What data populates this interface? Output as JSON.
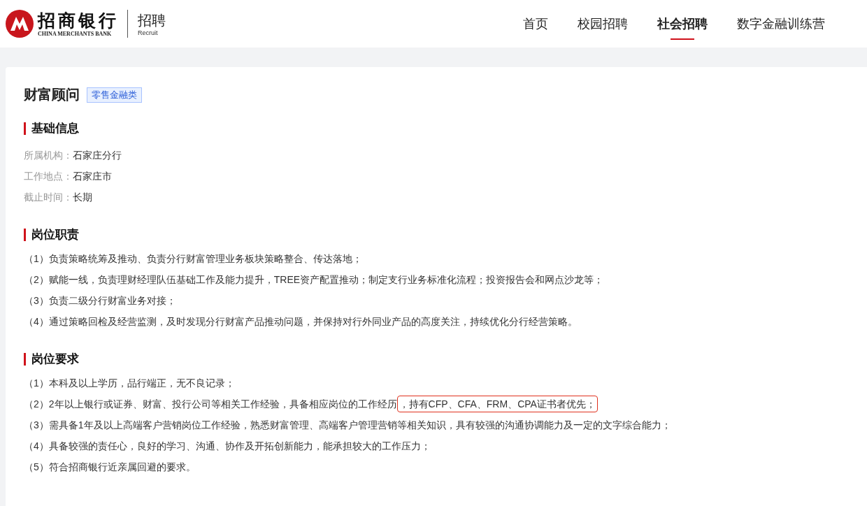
{
  "header": {
    "logo": {
      "name": "招商银行",
      "english": "CHINA MERCHANTS BANK",
      "section": "招聘",
      "section_english": "Recruit"
    },
    "nav": [
      {
        "label": "首页",
        "selected": false
      },
      {
        "label": "校园招聘",
        "selected": false
      },
      {
        "label": "社会招聘",
        "selected": true
      },
      {
        "label": "数字金融训练营",
        "selected": false
      }
    ]
  },
  "job": {
    "title": "财富顾问",
    "tag": "零售金融类",
    "sections": [
      {
        "heading": "基础信息",
        "kind": "fields",
        "fields": [
          {
            "label": "所属机构：",
            "value": "石家庄分行"
          },
          {
            "label": "工作地点：",
            "value": "石家庄市"
          },
          {
            "label": "截止时间：",
            "value": "长期"
          }
        ]
      },
      {
        "heading": "岗位职责",
        "kind": "list",
        "items": [
          {
            "text": "（1）负责策略统筹及推动、负责分行财富管理业务板块策略整合、传达落地；"
          },
          {
            "text": "（2）赋能一线，负责理财经理队伍基础工作及能力提升，TREE资产配置推动；制定支行业务标准化流程；投资报告会和网点沙龙等；"
          },
          {
            "text": "（3）负责二级分行财富业务对接；"
          },
          {
            "text": "（4）通过策略回检及经营监测，及时发现分行财富产品推动问题，并保持对行外同业产品的高度关注，持续优化分行经营策略。"
          }
        ]
      },
      {
        "heading": "岗位要求",
        "kind": "list",
        "items": [
          {
            "text": "（1）本科及以上学历，品行端正，无不良记录；"
          },
          {
            "text": "（2）2年以上银行或证券、财富、投行公司等相关工作经验，具备相应岗位的工作经历",
            "highlight": "，持有CFP、CFA、FRM、CPA证书者优先；"
          },
          {
            "text": "（3）需具备1年及以上高端客户营销岗位工作经验，熟悉财富管理、高端客户管理营销等相关知识，具有较强的沟通协调能力及一定的文字综合能力；"
          },
          {
            "text": "（4）具备较强的责任心，良好的学习、沟通、协作及开拓创新能力，能承担较大的工作压力；"
          },
          {
            "text": "（5）符合招商银行近亲属回避的要求。"
          }
        ]
      }
    ]
  }
}
